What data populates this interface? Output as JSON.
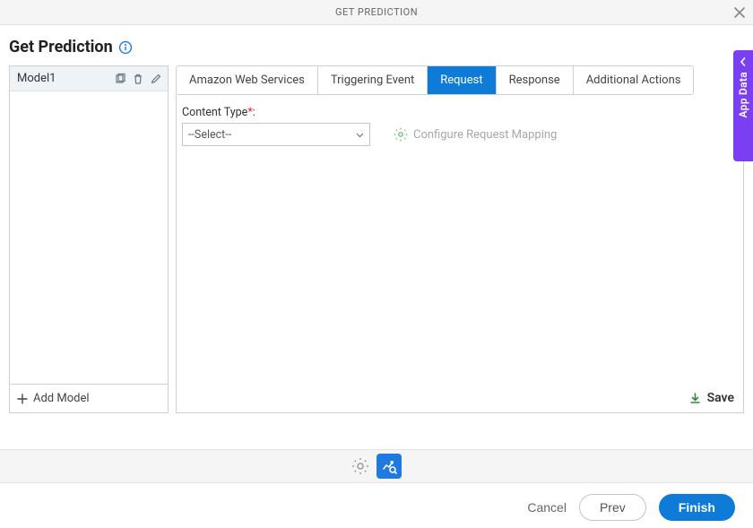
{
  "modal": {
    "title": "GET PREDICTION"
  },
  "page": {
    "title": "Get Prediction"
  },
  "side_panel": {
    "label": "App Data"
  },
  "sidebar": {
    "model_name": "Model1",
    "add_label": "Add Model"
  },
  "tabs": [
    {
      "label": "Amazon Web Services"
    },
    {
      "label": "Triggering Event"
    },
    {
      "label": "Request"
    },
    {
      "label": "Response"
    },
    {
      "label": "Additional Actions"
    }
  ],
  "form": {
    "content_type_label": "Content Type",
    "content_type_colon": ":",
    "select_placeholder": "--Select--",
    "configure_label": "Configure Request Mapping",
    "save_label": "Save"
  },
  "footer": {
    "cancel": "Cancel",
    "prev": "Prev",
    "finish": "Finish"
  }
}
